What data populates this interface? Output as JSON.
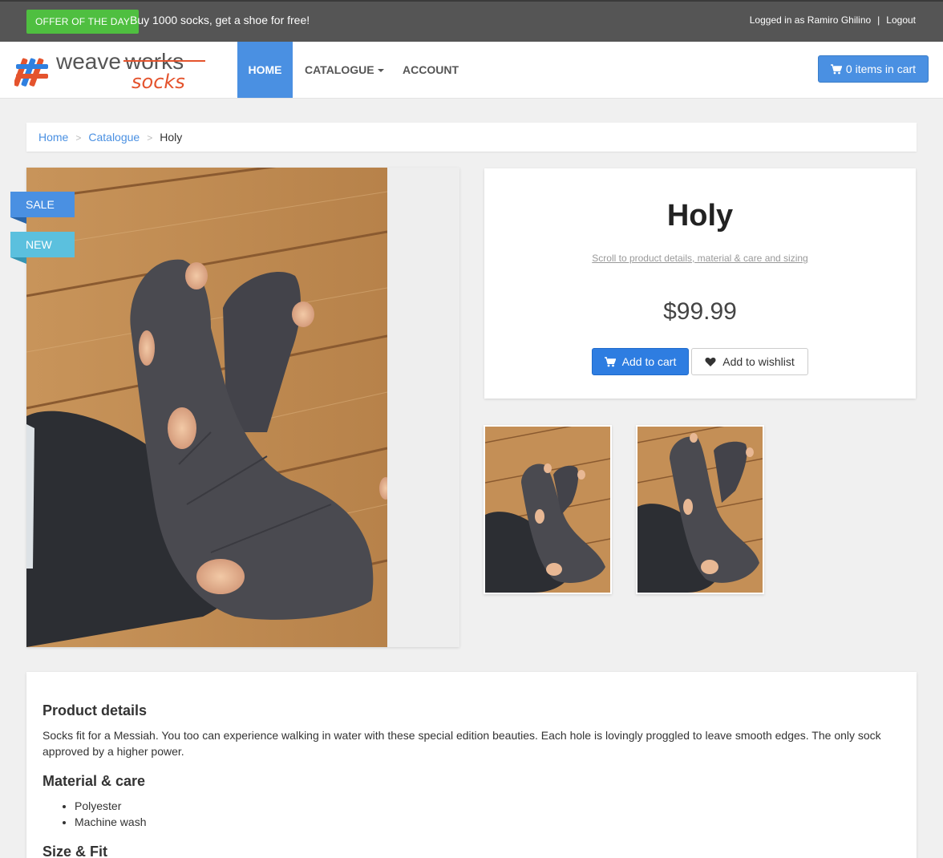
{
  "topbar": {
    "offer_badge": "OFFER OF THE DAY",
    "offer_text": "Buy 1000 socks, get a shoe for free!",
    "logged_in_text": "Logged in as Ramiro Ghilino",
    "separator": "|",
    "logout_label": "Logout"
  },
  "logo": {
    "word1": "weave",
    "word2": "works",
    "word3": "socks"
  },
  "nav": {
    "home": "HOME",
    "catalogue": "CATALOGUE",
    "account": "ACCOUNT",
    "cart_label": "0 items in cart"
  },
  "breadcrumb": {
    "home": "Home",
    "catalogue": "Catalogue",
    "current": "Holy",
    "sep": ">"
  },
  "badges": {
    "sale": "SALE",
    "new": "NEW"
  },
  "product": {
    "title": "Holy",
    "scroll_link": "Scroll to product details, material & care and sizing",
    "price": "$99.99",
    "add_to_cart": "Add to cart",
    "add_to_wishlist": "Add to wishlist"
  },
  "details": {
    "details_heading": "Product details",
    "description": "Socks fit for a Messiah. You too can experience walking in water with these special edition beauties. Each hole is lovingly proggled to leave smooth edges. The only sock approved by a higher power.",
    "material_heading": "Material & care",
    "materials": [
      "Polyester",
      "Machine wash"
    ],
    "size_heading": "Size & Fit"
  },
  "colors": {
    "topbar": "#555555",
    "offer_green": "#4fbf40",
    "accent_blue": "#4a90e2",
    "new_badge": "#5bc0de",
    "logo_red": "#e4532d"
  }
}
